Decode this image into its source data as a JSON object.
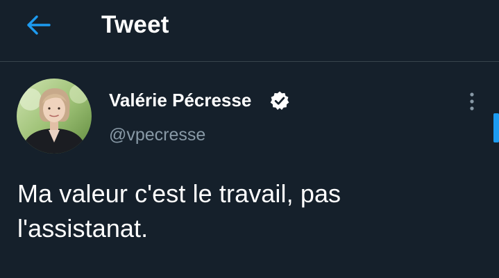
{
  "header": {
    "title": "Tweet",
    "back_icon": "arrow-left-icon"
  },
  "tweet": {
    "author": {
      "name": "Valérie Pécresse",
      "handle": "@vpecresse",
      "verified": true,
      "verified_icon": "verified-badge-icon",
      "avatar_icon": "profile-photo"
    },
    "menu_icon": "more-vertical-icon",
    "text": "Ma valeur c'est le travail, pas l'assistanat."
  },
  "colors": {
    "background": "#15202b",
    "divider": "#38444d",
    "accent": "#1d9bf0",
    "secondary_text": "#8899a6",
    "primary_text": "#ffffff"
  }
}
